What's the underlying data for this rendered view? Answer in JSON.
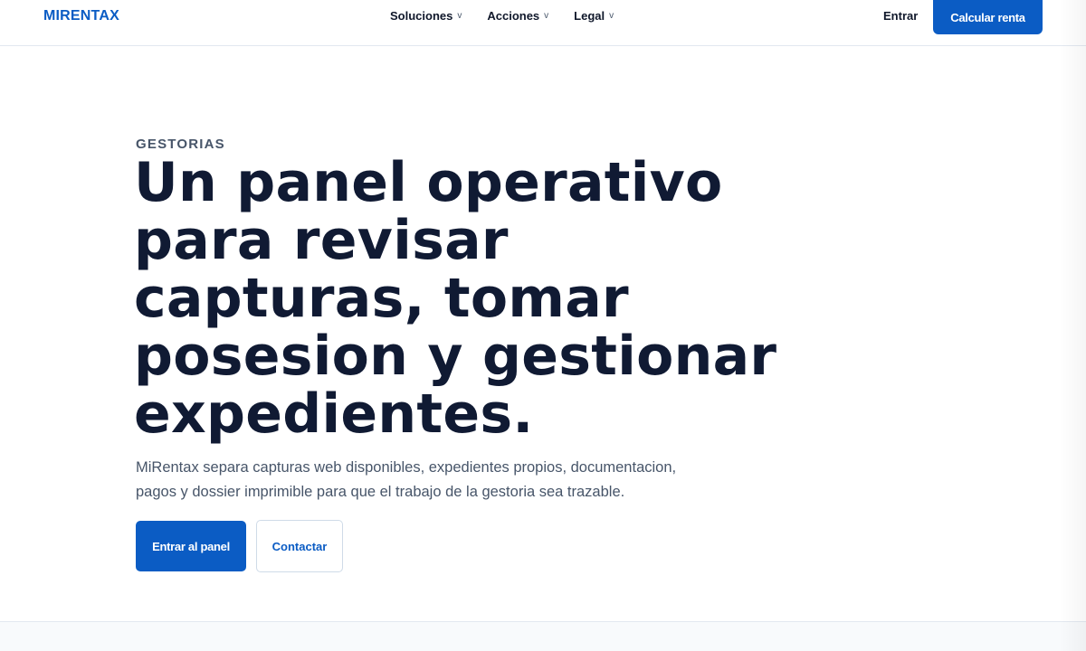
{
  "header": {
    "logo": "MIRENTAX",
    "nav": [
      {
        "label": "Soluciones",
        "chevron": "v"
      },
      {
        "label": "Acciones",
        "chevron": "v"
      },
      {
        "label": "Legal",
        "chevron": "v"
      }
    ],
    "login_label": "Entrar",
    "cta_label": "Calcular renta"
  },
  "hero": {
    "eyebrow": "GESTORIAS",
    "title": "Un panel operativo para revisar capturas, tomar posesion y gestionar expedientes.",
    "description": "MiRentax separa capturas web disponibles, expedientes propios, documentacion, pagos y dossier imprimible para que el trabajo de la gestoria sea trazable.",
    "primary_button": "Entrar al panel",
    "secondary_button": "Contactar"
  },
  "colors": {
    "brand": "#0b5cc4",
    "heading": "#101a33",
    "muted": "#475569"
  },
  "icons": {
    "nav_dropdown": "chevron-down-icon"
  }
}
